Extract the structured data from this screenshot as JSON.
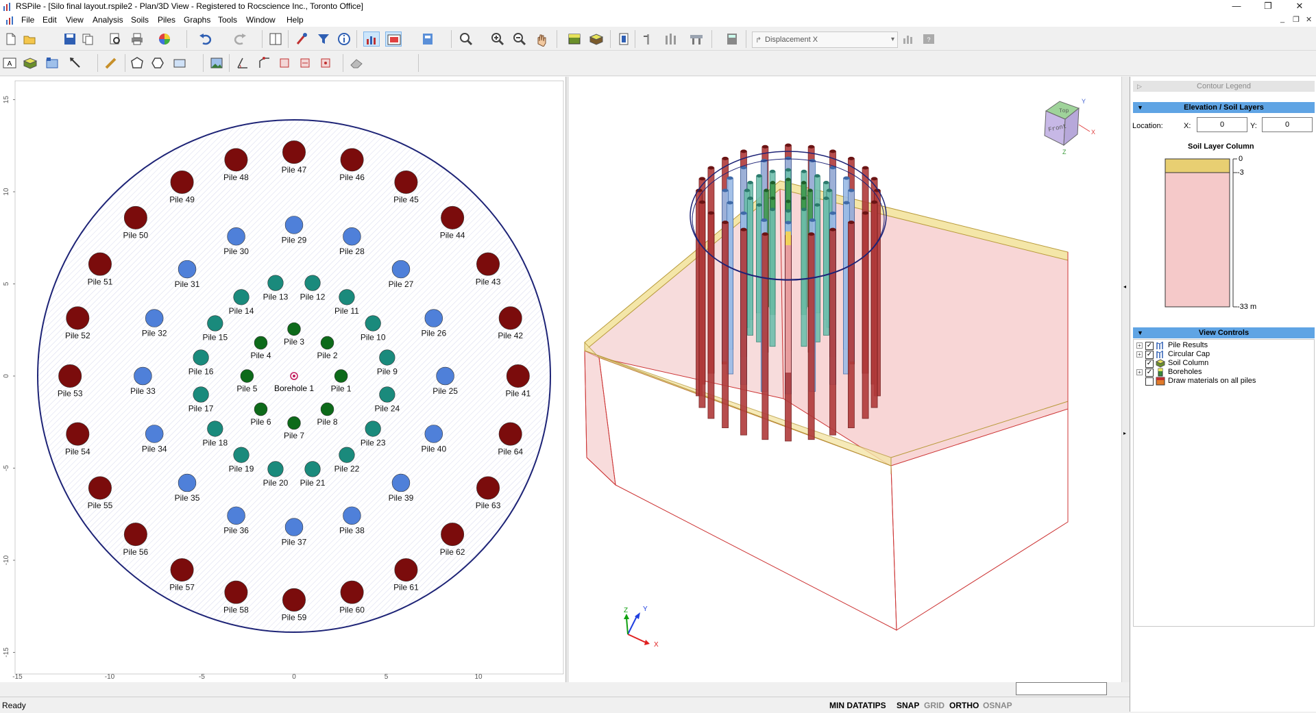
{
  "window": {
    "title": "RSPile - [Silo final layout.rspile2 - Plan/3D View - Registered to Rocscience Inc., Toronto Office]",
    "minimize": "—",
    "restore": "❐",
    "close": "✕",
    "mdi_minimize": "_",
    "mdi_restore": "❐",
    "mdi_close": "✕"
  },
  "menu": [
    "File",
    "Edit",
    "View",
    "Analysis",
    "Soils",
    "Piles",
    "Graphs",
    "Tools",
    "Window",
    "Help"
  ],
  "toolbar": {
    "result_type": "Displacement X"
  },
  "plan": {
    "x_ticks": [
      "-15",
      "-10",
      "-5",
      "0",
      "5",
      "10"
    ],
    "y_ticks": [
      "15",
      "10",
      "5",
      "0",
      "-5",
      "-10",
      "-15"
    ],
    "borehole": {
      "label": "Borehole 1",
      "color": "#c2185b"
    },
    "colors": {
      "outer": "#7b0c0c",
      "middle": "#4f80d9",
      "inner": "#1a8a7c",
      "core": "#0d6a1a",
      "boundary": "#1d2376"
    },
    "piles": [
      {
        "label": "Pile 1"
      },
      {
        "label": "Pile 2"
      },
      {
        "label": "Pile 3"
      },
      {
        "label": "Pile 4"
      },
      {
        "label": "Pile 5"
      },
      {
        "label": "Pile 6"
      },
      {
        "label": "Pile 7"
      },
      {
        "label": "Pile 8"
      },
      {
        "label": "Pile 9"
      },
      {
        "label": "Pile 10"
      },
      {
        "label": "Pile 11"
      },
      {
        "label": "Pile 12"
      },
      {
        "label": "Pile 13"
      },
      {
        "label": "Pile 14"
      },
      {
        "label": "Pile 15"
      },
      {
        "label": "Pile 16"
      },
      {
        "label": "Pile 17"
      },
      {
        "label": "Pile 18"
      },
      {
        "label": "Pile 19"
      },
      {
        "label": "Pile 20"
      },
      {
        "label": "Pile 21"
      },
      {
        "label": "Pile 22"
      },
      {
        "label": "Pile 23"
      },
      {
        "label": "Pile 24"
      },
      {
        "label": "Pile 25"
      },
      {
        "label": "Pile 26"
      },
      {
        "label": "Pile 27"
      },
      {
        "label": "Pile 28"
      },
      {
        "label": "Pile 29"
      },
      {
        "label": "Pile 30"
      },
      {
        "label": "Pile 31"
      },
      {
        "label": "Pile 32"
      },
      {
        "label": "Pile 33"
      },
      {
        "label": "Pile 34"
      },
      {
        "label": "Pile 35"
      },
      {
        "label": "Pile 36"
      },
      {
        "label": "Pile 37"
      },
      {
        "label": "Pile 38"
      },
      {
        "label": "Pile 39"
      },
      {
        "label": "Pile 40"
      },
      {
        "label": "Pile 41"
      },
      {
        "label": "Pile 42"
      },
      {
        "label": "Pile 43"
      },
      {
        "label": "Pile 44"
      },
      {
        "label": "Pile 45"
      },
      {
        "label": "Pile 46"
      },
      {
        "label": "Pile 47"
      },
      {
        "label": "Pile 48"
      },
      {
        "label": "Pile 49"
      },
      {
        "label": "Pile 50"
      },
      {
        "label": "Pile 51"
      },
      {
        "label": "Pile 52"
      },
      {
        "label": "Pile 53"
      },
      {
        "label": "Pile 54"
      },
      {
        "label": "Pile 55"
      },
      {
        "label": "Pile 56"
      },
      {
        "label": "Pile 57"
      },
      {
        "label": "Pile 58"
      },
      {
        "label": "Pile 59"
      },
      {
        "label": "Pile 60"
      },
      {
        "label": "Pile 61"
      },
      {
        "label": "Pile 62"
      },
      {
        "label": "Pile 63"
      },
      {
        "label": "Pile 64"
      }
    ]
  },
  "view3d": {
    "axis_labels": {
      "x": "X",
      "y": "Y",
      "z": "Z"
    },
    "cube_labels": {
      "top": "Top",
      "front": "Front"
    }
  },
  "sidebar": {
    "contour_legend": "Contour Legend",
    "elevation_header": "Elevation / Soil Layers",
    "location_label": "Location:",
    "x_label": "X:",
    "x_value": "0",
    "y_label": "Y:",
    "y_value": "0",
    "soil_column_title": "Soil Layer Column",
    "elevations": [
      "0",
      "-3",
      "-33 m"
    ],
    "view_controls_header": "View Controls",
    "view_controls": [
      {
        "label": "Pile Results",
        "checked": true,
        "expandable": true
      },
      {
        "label": "Circular Cap",
        "checked": true,
        "expandable": true
      },
      {
        "label": "Soil Column",
        "checked": true,
        "expandable": false
      },
      {
        "label": "Boreholes",
        "checked": true,
        "expandable": true
      },
      {
        "label": "Draw materials on all piles",
        "checked": false,
        "expandable": false
      }
    ]
  },
  "status": {
    "text": "Ready",
    "min_datatips": "MIN DATATIPS",
    "snap": "SNAP",
    "grid": "GRID",
    "ortho": "ORTHO",
    "osnap": "OSNAP"
  }
}
